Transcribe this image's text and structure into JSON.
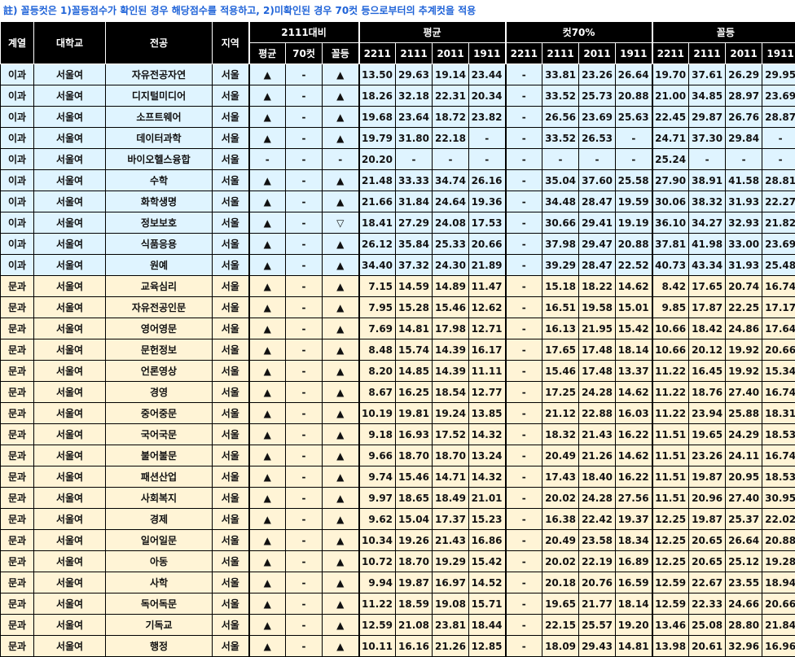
{
  "note": "註) 꼴등컷은 1)꼴등점수가 확인된 경우 해당점수를 적용하고, 2)미확인된 경우 70컷 등으로부터의 추계컷을 적용",
  "headers": {
    "group": "계열",
    "univ": "대학교",
    "major": "전공",
    "region": "지역",
    "compare": "2111대비",
    "avg": "평균",
    "cut70": "컷70%",
    "last": "꼴등",
    "cmp_sub": [
      "평균",
      "70컷",
      "꼴등"
    ],
    "years": [
      "2211",
      "2111",
      "2011",
      "1911"
    ]
  },
  "rows": [
    {
      "g": "이과",
      "u": "서울여",
      "m": "자유전공자연",
      "r": "서울",
      "c": [
        "▲",
        "-",
        "▲"
      ],
      "a": [
        "13.50",
        "29.63",
        "19.14",
        "23.44"
      ],
      "s": [
        "-",
        "33.81",
        "23.26",
        "26.64"
      ],
      "l": [
        "19.70",
        "37.61",
        "26.29",
        "29.95"
      ]
    },
    {
      "g": "이과",
      "u": "서울여",
      "m": "디지털미디어",
      "r": "서울",
      "c": [
        "▲",
        "-",
        "▲"
      ],
      "a": [
        "18.26",
        "32.18",
        "22.31",
        "20.34"
      ],
      "s": [
        "-",
        "33.52",
        "25.73",
        "20.88"
      ],
      "l": [
        "21.00",
        "34.85",
        "28.97",
        "23.69"
      ]
    },
    {
      "g": "이과",
      "u": "서울여",
      "m": "소프트웨어",
      "r": "서울",
      "c": [
        "▲",
        "-",
        "▲"
      ],
      "a": [
        "19.68",
        "23.64",
        "18.72",
        "23.82"
      ],
      "s": [
        "-",
        "26.56",
        "23.69",
        "25.63"
      ],
      "l": [
        "22.45",
        "29.87",
        "26.76",
        "28.87"
      ]
    },
    {
      "g": "이과",
      "u": "서울여",
      "m": "데이터과학",
      "r": "서울",
      "c": [
        "▲",
        "-",
        "▲"
      ],
      "a": [
        "19.79",
        "31.80",
        "22.18",
        "-"
      ],
      "s": [
        "-",
        "33.52",
        "26.53",
        "-"
      ],
      "l": [
        "24.71",
        "37.30",
        "29.84",
        "-"
      ]
    },
    {
      "g": "이과",
      "u": "서울여",
      "m": "바이오헬스융합",
      "r": "서울",
      "c": [
        "-",
        "-",
        "-"
      ],
      "a": [
        "20.20",
        "-",
        "-",
        "-"
      ],
      "s": [
        "-",
        "-",
        "-",
        "-"
      ],
      "l": [
        "25.24",
        "-",
        "-",
        "-"
      ]
    },
    {
      "g": "이과",
      "u": "서울여",
      "m": "수학",
      "r": "서울",
      "c": [
        "▲",
        "-",
        "▲"
      ],
      "a": [
        "21.48",
        "33.33",
        "34.74",
        "26.16"
      ],
      "s": [
        "-",
        "35.04",
        "37.60",
        "25.58"
      ],
      "l": [
        "27.90",
        "38.91",
        "41.58",
        "28.81"
      ]
    },
    {
      "g": "이과",
      "u": "서울여",
      "m": "화학생명",
      "r": "서울",
      "c": [
        "▲",
        "-",
        "▲"
      ],
      "a": [
        "21.66",
        "31.84",
        "24.64",
        "19.36"
      ],
      "s": [
        "-",
        "34.48",
        "28.47",
        "19.59"
      ],
      "l": [
        "30.06",
        "38.32",
        "31.93",
        "22.27"
      ]
    },
    {
      "g": "이과",
      "u": "서울여",
      "m": "정보보호",
      "r": "서울",
      "c": [
        "▲",
        "-",
        "▽"
      ],
      "a": [
        "18.41",
        "27.29",
        "24.08",
        "17.53"
      ],
      "s": [
        "-",
        "30.66",
        "29.41",
        "19.19"
      ],
      "l": [
        "36.10",
        "34.27",
        "32.93",
        "21.82"
      ]
    },
    {
      "g": "이과",
      "u": "서울여",
      "m": "식품응용",
      "r": "서울",
      "c": [
        "▲",
        "-",
        "▲"
      ],
      "a": [
        "26.12",
        "35.84",
        "25.33",
        "20.66"
      ],
      "s": [
        "-",
        "37.98",
        "29.47",
        "20.88"
      ],
      "l": [
        "37.81",
        "41.98",
        "33.00",
        "23.69"
      ]
    },
    {
      "g": "이과",
      "u": "서울여",
      "m": "원예",
      "r": "서울",
      "c": [
        "▲",
        "-",
        "▲"
      ],
      "a": [
        "34.40",
        "37.32",
        "24.30",
        "21.89"
      ],
      "s": [
        "-",
        "39.29",
        "28.47",
        "22.52"
      ],
      "l": [
        "40.73",
        "43.34",
        "31.93",
        "25.48"
      ]
    },
    {
      "g": "문과",
      "u": "서울여",
      "m": "교육심리",
      "r": "서울",
      "c": [
        "▲",
        "-",
        "▲"
      ],
      "a": [
        "7.15",
        "14.59",
        "14.89",
        "11.47"
      ],
      "s": [
        "-",
        "15.18",
        "18.22",
        "14.62"
      ],
      "l": [
        "8.42",
        "17.65",
        "20.74",
        "16.74"
      ]
    },
    {
      "g": "문과",
      "u": "서울여",
      "m": "자유전공인문",
      "r": "서울",
      "c": [
        "▲",
        "-",
        "▲"
      ],
      "a": [
        "7.95",
        "15.28",
        "15.46",
        "12.62"
      ],
      "s": [
        "-",
        "16.51",
        "19.58",
        "15.01"
      ],
      "l": [
        "9.85",
        "17.87",
        "22.25",
        "17.17"
      ]
    },
    {
      "g": "문과",
      "u": "서울여",
      "m": "영어영문",
      "r": "서울",
      "c": [
        "▲",
        "-",
        "▲"
      ],
      "a": [
        "7.69",
        "14.81",
        "17.98",
        "12.71"
      ],
      "s": [
        "-",
        "16.13",
        "21.95",
        "15.42"
      ],
      "l": [
        "10.66",
        "18.42",
        "24.86",
        "17.64"
      ]
    },
    {
      "g": "문과",
      "u": "서울여",
      "m": "문헌정보",
      "r": "서울",
      "c": [
        "▲",
        "-",
        "▲"
      ],
      "a": [
        "8.48",
        "15.74",
        "14.39",
        "16.17"
      ],
      "s": [
        "-",
        "17.65",
        "17.48",
        "18.14"
      ],
      "l": [
        "10.66",
        "20.12",
        "19.92",
        "20.66"
      ]
    },
    {
      "g": "문과",
      "u": "서울여",
      "m": "언론영상",
      "r": "서울",
      "c": [
        "▲",
        "-",
        "▲"
      ],
      "a": [
        "8.20",
        "14.85",
        "14.39",
        "11.11"
      ],
      "s": [
        "-",
        "15.46",
        "17.48",
        "13.37"
      ],
      "l": [
        "11.22",
        "16.45",
        "19.92",
        "15.34"
      ]
    },
    {
      "g": "문과",
      "u": "서울여",
      "m": "경영",
      "r": "서울",
      "c": [
        "▲",
        "-",
        "▲"
      ],
      "a": [
        "8.67",
        "16.25",
        "18.54",
        "12.77"
      ],
      "s": [
        "-",
        "17.25",
        "24.28",
        "14.62"
      ],
      "l": [
        "11.22",
        "18.76",
        "27.40",
        "16.74"
      ]
    },
    {
      "g": "문과",
      "u": "서울여",
      "m": "중어중문",
      "r": "서울",
      "c": [
        "▲",
        "-",
        "▲"
      ],
      "a": [
        "10.19",
        "19.81",
        "19.24",
        "13.85"
      ],
      "s": [
        "-",
        "21.12",
        "22.88",
        "16.03"
      ],
      "l": [
        "11.22",
        "23.94",
        "25.88",
        "18.31"
      ]
    },
    {
      "g": "문과",
      "u": "서울여",
      "m": "국어국문",
      "r": "서울",
      "c": [
        "▲",
        "-",
        "▲"
      ],
      "a": [
        "9.18",
        "16.93",
        "17.52",
        "14.32"
      ],
      "s": [
        "-",
        "18.32",
        "21.43",
        "16.22"
      ],
      "l": [
        "11.51",
        "19.65",
        "24.29",
        "18.53"
      ]
    },
    {
      "g": "문과",
      "u": "서울여",
      "m": "불어불문",
      "r": "서울",
      "c": [
        "▲",
        "-",
        "▲"
      ],
      "a": [
        "9.66",
        "18.70",
        "18.70",
        "13.24"
      ],
      "s": [
        "-",
        "20.49",
        "21.26",
        "14.62"
      ],
      "l": [
        "11.51",
        "23.26",
        "24.11",
        "16.74"
      ]
    },
    {
      "g": "문과",
      "u": "서울여",
      "m": "패션산업",
      "r": "서울",
      "c": [
        "▲",
        "-",
        "▲"
      ],
      "a": [
        "9.74",
        "15.46",
        "14.71",
        "14.32"
      ],
      "s": [
        "-",
        "17.43",
        "18.40",
        "16.22"
      ],
      "l": [
        "11.51",
        "19.87",
        "20.95",
        "18.53"
      ]
    },
    {
      "g": "문과",
      "u": "서울여",
      "m": "사회복지",
      "r": "서울",
      "c": [
        "▲",
        "-",
        "▲"
      ],
      "a": [
        "9.97",
        "18.65",
        "18.49",
        "21.01"
      ],
      "s": [
        "-",
        "20.02",
        "24.28",
        "27.56"
      ],
      "l": [
        "11.51",
        "20.96",
        "27.40",
        "30.95"
      ]
    },
    {
      "g": "문과",
      "u": "서울여",
      "m": "경제",
      "r": "서울",
      "c": [
        "▲",
        "-",
        "▲"
      ],
      "a": [
        "9.62",
        "15.04",
        "17.37",
        "15.23"
      ],
      "s": [
        "-",
        "16.38",
        "22.42",
        "19.37"
      ],
      "l": [
        "12.25",
        "19.87",
        "25.37",
        "22.02"
      ]
    },
    {
      "g": "문과",
      "u": "서울여",
      "m": "일어일문",
      "r": "서울",
      "c": [
        "▲",
        "-",
        "▲"
      ],
      "a": [
        "10.34",
        "19.26",
        "21.43",
        "16.86"
      ],
      "s": [
        "-",
        "20.49",
        "23.58",
        "18.34"
      ],
      "l": [
        "12.25",
        "20.65",
        "26.64",
        "20.88"
      ]
    },
    {
      "g": "문과",
      "u": "서울여",
      "m": "아동",
      "r": "서울",
      "c": [
        "▲",
        "-",
        "▲"
      ],
      "a": [
        "10.72",
        "18.70",
        "19.29",
        "15.42"
      ],
      "s": [
        "-",
        "20.02",
        "22.19",
        "16.89"
      ],
      "l": [
        "12.25",
        "20.65",
        "25.12",
        "19.28"
      ]
    },
    {
      "g": "문과",
      "u": "서울여",
      "m": "사학",
      "r": "서울",
      "c": [
        "▲",
        "-",
        "▲"
      ],
      "a": [
        "9.94",
        "19.87",
        "16.97",
        "14.52"
      ],
      "s": [
        "-",
        "20.18",
        "20.76",
        "16.59"
      ],
      "l": [
        "12.59",
        "22.67",
        "23.55",
        "18.94"
      ]
    },
    {
      "g": "문과",
      "u": "서울여",
      "m": "독어독문",
      "r": "서울",
      "c": [
        "▲",
        "-",
        "▲"
      ],
      "a": [
        "11.22",
        "18.59",
        "19.08",
        "15.71"
      ],
      "s": [
        "-",
        "19.65",
        "21.77",
        "18.14"
      ],
      "l": [
        "12.59",
        "22.33",
        "24.66",
        "20.66"
      ]
    },
    {
      "g": "문과",
      "u": "서울여",
      "m": "기독교",
      "r": "서울",
      "c": [
        "▲",
        "-",
        "▲"
      ],
      "a": [
        "12.59",
        "21.08",
        "23.81",
        "18.44"
      ],
      "s": [
        "-",
        "22.15",
        "25.57",
        "19.20"
      ],
      "l": [
        "13.46",
        "25.08",
        "28.80",
        "21.84"
      ]
    },
    {
      "g": "문과",
      "u": "서울여",
      "m": "행정",
      "r": "서울",
      "c": [
        "▲",
        "-",
        "▲"
      ],
      "a": [
        "10.11",
        "16.16",
        "21.26",
        "12.85"
      ],
      "s": [
        "-",
        "18.09",
        "29.43",
        "14.81"
      ],
      "l": [
        "13.98",
        "20.61",
        "32.96",
        "16.96"
      ]
    }
  ]
}
